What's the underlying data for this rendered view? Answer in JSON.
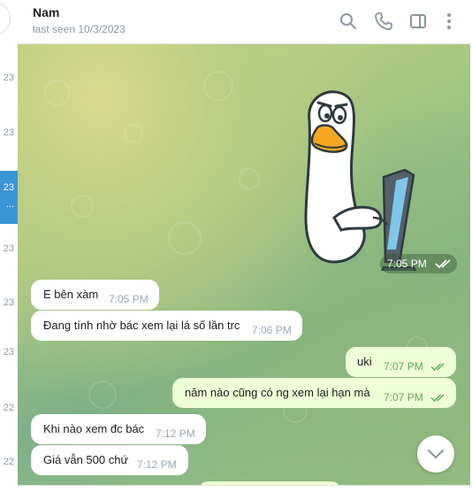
{
  "chat_list_strip": {
    "dates": [
      "23",
      "23",
      "23",
      "23",
      "23",
      "22",
      "22"
    ],
    "active_date": "23",
    "active_more": "..."
  },
  "header": {
    "name": "Nam",
    "status": "last seen 10/3/2023",
    "icons": [
      "search-icon",
      "phone-icon",
      "sidebar-toggle-icon",
      "more-vertical-icon"
    ]
  },
  "messages": {
    "sticker": {
      "description_icon": "duck-at-computer-sticker",
      "time": "7:05 PM",
      "read": true
    },
    "m1": {
      "text": "E bên xàm",
      "time": "7:05 PM",
      "direction": "in"
    },
    "m2": {
      "text": "Đang tính nhờ bác xem lại lá số lần trc",
      "time": "7:06 PM",
      "direction": "in"
    },
    "m3": {
      "text": "uki",
      "time": "7:07 PM",
      "direction": "out",
      "read": true
    },
    "m4": {
      "text": "năm nào cũng có ng xem lại hạn mà",
      "time": "7:07 PM",
      "direction": "out",
      "read": true
    },
    "m5": {
      "text": "Khi nào xem đc bác",
      "time": "7:12 PM",
      "direction": "in"
    },
    "m6": {
      "text": "Giá vẫn 500 chứ",
      "time": "7:12 PM",
      "direction": "in"
    }
  },
  "colors": {
    "incoming_bubble": "#ffffff",
    "outgoing_bubble": "#eefed6",
    "outgoing_time": "#5eaa5a",
    "active_chat": "#3a95d5"
  }
}
